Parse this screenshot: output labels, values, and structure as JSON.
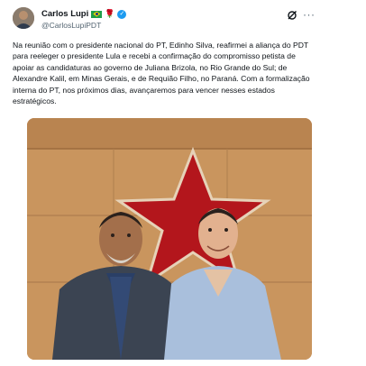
{
  "post": {
    "author_name": "Carlos Lupi",
    "author_handle": "@CarlosLupiPDT",
    "text": "Na reunião com o presidente nacional do PT, Edinho Silva, reafirmei a aliança do PDT para reeleger o presidente Lula e recebi a confirmação do compromisso petista de apoiar as candidaturas ao governo de Juliana Brizola, no Rio Grande do Sul; de Alexandre Kalil, em Minas Gerais, e de Requião Filho, no Paraná. Com a formalização interna do PT, nos próximos dias, avançaremos para vencer nesses estados estratégicos.",
    "icons": {
      "avatar": "avatar",
      "flag": "brazil-flag-icon",
      "rose": "rose-icon",
      "verified": "verified-badge-icon",
      "grok": "grok-icon",
      "more": "more-options-icon"
    }
  },
  "colors": {
    "verified": "#1d9bf0",
    "star": "#b3161c",
    "wall": "#c9955e",
    "handle": "#536471"
  }
}
